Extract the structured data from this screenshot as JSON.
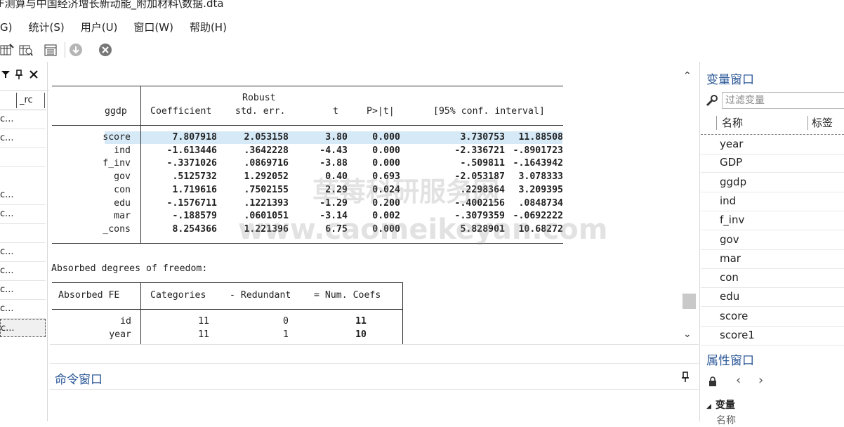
{
  "window": {
    "title": "F测算与中国经济增长新动能_附加材料\\数据.dta"
  },
  "menu": {
    "items": [
      "G)",
      "统计(S)",
      "用户(U)",
      "窗口(W)",
      "帮助(H)"
    ]
  },
  "left_panel": {
    "header": "_rc",
    "rows": [
      "c...",
      "c...",
      "",
      "c...",
      "c...",
      "",
      "c...",
      "c...",
      "c...",
      "c...",
      "c..."
    ]
  },
  "results": {
    "header1": "Robust",
    "dep": "ggdp",
    "cols": [
      "Coefficient",
      "std. err.",
      "t",
      "P>|t|",
      "[95% conf. interval]"
    ],
    "rows": [
      {
        "var": "score",
        "coef": "7.807918",
        "se": "2.053158",
        "t": "3.80",
        "p": "0.000",
        "lo": "3.730753",
        "hi": "11.88508"
      },
      {
        "var": "ind",
        "coef": "-1.613446",
        "se": ".3642228",
        "t": "-4.43",
        "p": "0.000",
        "lo": "-2.336721",
        "hi": "-.8901723"
      },
      {
        "var": "f_inv",
        "coef": "-.3371026",
        "se": ".0869716",
        "t": "-3.88",
        "p": "0.000",
        "lo": "-.509811",
        "hi": "-.1643942"
      },
      {
        "var": "gov",
        "coef": ".5125732",
        "se": "1.292052",
        "t": "0.40",
        "p": "0.693",
        "lo": "-2.053187",
        "hi": "3.078333"
      },
      {
        "var": "con",
        "coef": "1.719616",
        "se": ".7502155",
        "t": "2.29",
        "p": "0.024",
        "lo": ".2298364",
        "hi": "3.209395"
      },
      {
        "var": "edu",
        "coef": "-.1576711",
        "se": ".1221393",
        "t": "-1.29",
        "p": "0.200",
        "lo": "-.4002156",
        "hi": ".0848734"
      },
      {
        "var": "mar",
        "coef": "-.188579",
        "se": ".0601051",
        "t": "-3.14",
        "p": "0.002",
        "lo": "-.3079359",
        "hi": "-.0692222"
      },
      {
        "var": "_cons",
        "coef": "8.254366",
        "se": "1.221396",
        "t": "6.75",
        "p": "0.000",
        "lo": "5.828901",
        "hi": "10.68272"
      }
    ],
    "absorbed_text": "Absorbed degrees of freedom:",
    "fe_header": [
      "Absorbed FE",
      "Categories",
      "- Redundant",
      "= Num. Coefs"
    ],
    "fe_rows": [
      {
        "name": "id",
        "cat": "11",
        "red": "0",
        "num": "11"
      },
      {
        "name": "year",
        "cat": "11",
        "red": "1",
        "num": "10"
      }
    ],
    "watermark1": "草莓科研服务网",
    "watermark2": "www.caomeikeyan.com"
  },
  "command_window": {
    "title": "命令窗口"
  },
  "variables_window": {
    "title": "变量窗口",
    "filter_placeholder": "过滤变量",
    "col_name": "名称",
    "col_label": "标签",
    "variables": [
      "year",
      "GDP",
      "ggdp",
      "ind",
      "f_inv",
      "gov",
      "mar",
      "con",
      "edu",
      "score",
      "score1"
    ]
  },
  "properties_window": {
    "title": "属性窗口",
    "section": "变量",
    "partial_label": "名称"
  }
}
